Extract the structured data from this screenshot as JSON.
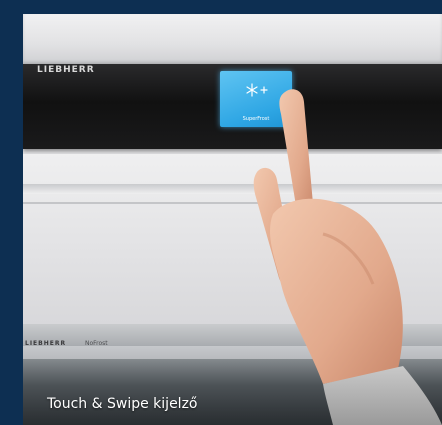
{
  "control_panel": {
    "brand": "LIEBHERR",
    "button_label": "SuperFrost",
    "button_icon": "snowflake-icon"
  },
  "lower_panel": {
    "brand": "LIEBHERR",
    "feature": "NoFrost"
  },
  "caption": "Touch & Swipe kijelző",
  "colors": {
    "background": "#0d2f52",
    "superfrost_button": "#2ea6e4"
  }
}
